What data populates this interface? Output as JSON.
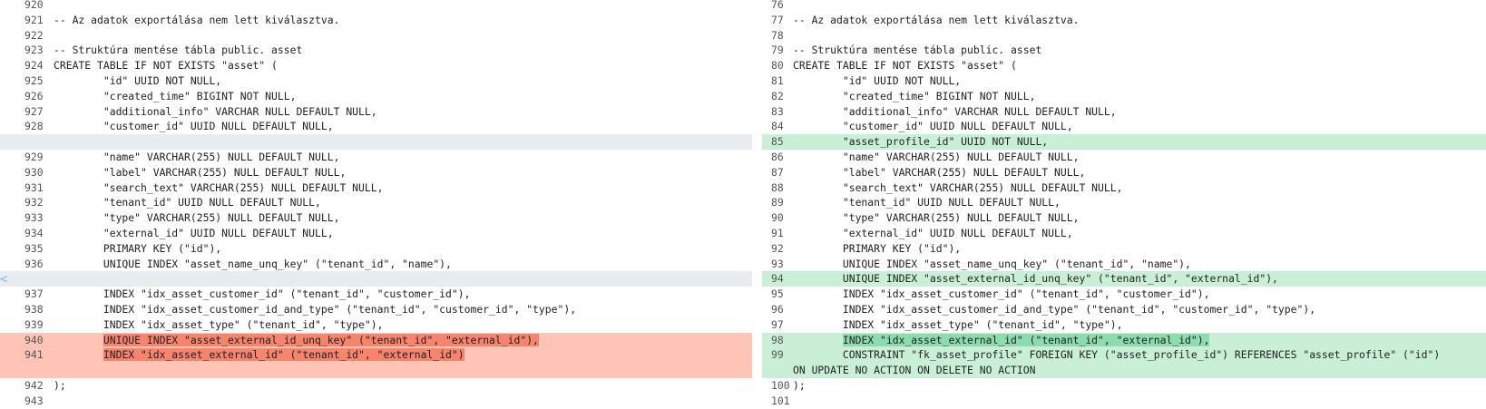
{
  "left": {
    "lines": [
      {
        "n": "920",
        "t": ""
      },
      {
        "n": "921",
        "t": "-- Az adatok exportálása nem lett kiválasztva."
      },
      {
        "n": "922",
        "t": ""
      },
      {
        "n": "923",
        "t": "-- Struktúra mentése tábla public. asset"
      },
      {
        "n": "924",
        "t": "CREATE TABLE IF NOT EXISTS \"asset\" ("
      },
      {
        "n": "925",
        "t": "        \"id\" UUID NOT NULL,"
      },
      {
        "n": "926",
        "t": "        \"created_time\" BIGINT NOT NULL,"
      },
      {
        "n": "927",
        "t": "        \"additional_info\" VARCHAR NULL DEFAULT NULL,"
      },
      {
        "n": "928",
        "t": "        \"customer_id\" UUID NULL DEFAULT NULL,"
      },
      {
        "n": "",
        "t": ""
      },
      {
        "n": "929",
        "t": "        \"name\" VARCHAR(255) NULL DEFAULT NULL,"
      },
      {
        "n": "930",
        "t": "        \"label\" VARCHAR(255) NULL DEFAULT NULL,"
      },
      {
        "n": "931",
        "t": "        \"search_text\" VARCHAR(255) NULL DEFAULT NULL,"
      },
      {
        "n": "932",
        "t": "        \"tenant_id\" UUID NULL DEFAULT NULL,"
      },
      {
        "n": "933",
        "t": "        \"type\" VARCHAR(255) NULL DEFAULT NULL,"
      },
      {
        "n": "934",
        "t": "        \"external_id\" UUID NULL DEFAULT NULL,"
      },
      {
        "n": "935",
        "t": "        PRIMARY KEY (\"id\"),"
      },
      {
        "n": "936",
        "t": "        UNIQUE INDEX \"asset_name_unq_key\" (\"tenant_id\", \"name\"),"
      },
      {
        "n": "",
        "t": ""
      },
      {
        "n": "937",
        "t": "        INDEX \"idx_asset_customer_id\" (\"tenant_id\", \"customer_id\"),"
      },
      {
        "n": "938",
        "t": "        INDEX \"idx_asset_customer_id_and_type\" (\"tenant_id\", \"customer_id\", \"type\"),"
      },
      {
        "n": "939",
        "t": "        INDEX \"idx_asset_type\" (\"tenant_id\", \"type\"),"
      },
      {
        "n": "940",
        "p": "        ",
        "h": "UNIQUE INDEX \"asset_external_id_unq_key\" (\"tenant_id\", \"external_id\"),"
      },
      {
        "n": "941",
        "p": "        ",
        "h": "INDEX \"idx_asset_external_id\" (\"tenant_id\", \"external_id\")"
      },
      {
        "n": "942",
        "t": ");"
      },
      {
        "n": "943",
        "t": ""
      }
    ]
  },
  "right": {
    "lines": [
      {
        "n": "76",
        "t": ""
      },
      {
        "n": "77",
        "t": "-- Az adatok exportálása nem lett kiválasztva."
      },
      {
        "n": "78",
        "t": ""
      },
      {
        "n": "79",
        "t": "-- Struktúra mentése tábla public. asset"
      },
      {
        "n": "80",
        "t": "CREATE TABLE IF NOT EXISTS \"asset\" ("
      },
      {
        "n": "81",
        "t": "        \"id\" UUID NOT NULL,"
      },
      {
        "n": "82",
        "t": "        \"created_time\" BIGINT NOT NULL,"
      },
      {
        "n": "83",
        "t": "        \"additional_info\" VARCHAR NULL DEFAULT NULL,"
      },
      {
        "n": "84",
        "t": "        \"customer_id\" UUID NULL DEFAULT NULL,"
      },
      {
        "n": "85",
        "t": "        \"asset_profile_id\" UUID NOT NULL,"
      },
      {
        "n": "86",
        "t": "        \"name\" VARCHAR(255) NULL DEFAULT NULL,"
      },
      {
        "n": "87",
        "t": "        \"label\" VARCHAR(255) NULL DEFAULT NULL,"
      },
      {
        "n": "88",
        "t": "        \"search_text\" VARCHAR(255) NULL DEFAULT NULL,"
      },
      {
        "n": "89",
        "t": "        \"tenant_id\" UUID NULL DEFAULT NULL,"
      },
      {
        "n": "90",
        "t": "        \"type\" VARCHAR(255) NULL DEFAULT NULL,"
      },
      {
        "n": "91",
        "t": "        \"external_id\" UUID NULL DEFAULT NULL,"
      },
      {
        "n": "92",
        "t": "        PRIMARY KEY (\"id\"),"
      },
      {
        "n": "93",
        "t": "        UNIQUE INDEX \"asset_name_unq_key\" (\"tenant_id\", \"name\"),"
      },
      {
        "n": "94",
        "t": "        UNIQUE INDEX \"asset_external_id_unq_key\" (\"tenant_id\", \"external_id\"),"
      },
      {
        "n": "95",
        "t": "        INDEX \"idx_asset_customer_id\" (\"tenant_id\", \"customer_id\"),"
      },
      {
        "n": "96",
        "t": "        INDEX \"idx_asset_customer_id_and_type\" (\"tenant_id\", \"customer_id\", \"type\"),"
      },
      {
        "n": "97",
        "t": "        INDEX \"idx_asset_type\" (\"tenant_id\", \"type\"),"
      },
      {
        "n": "98",
        "p": "        ",
        "h": "INDEX \"idx_asset_external_id\" (\"tenant_id\", \"external_id\"),"
      },
      {
        "n": "99",
        "t": "        CONSTRAINT \"fk_asset_profile\" FOREIGN KEY (\"asset_profile_id\") REFERENCES \"asset_profile\" (\"id\")",
        "w": "ON UPDATE NO ACTION ON DELETE NO ACTION"
      },
      {
        "n": "100",
        "t": ");"
      },
      {
        "n": "101",
        "t": ""
      }
    ]
  },
  "gutter": {
    "arrow_glyph": "<"
  },
  "colors": {
    "deleted_line": "#ffc4b6",
    "deleted_word": "#f7846c",
    "added_line": "#c9f0d7",
    "added_word": "#8ddcb0",
    "placeholder": "#e8ecef"
  }
}
